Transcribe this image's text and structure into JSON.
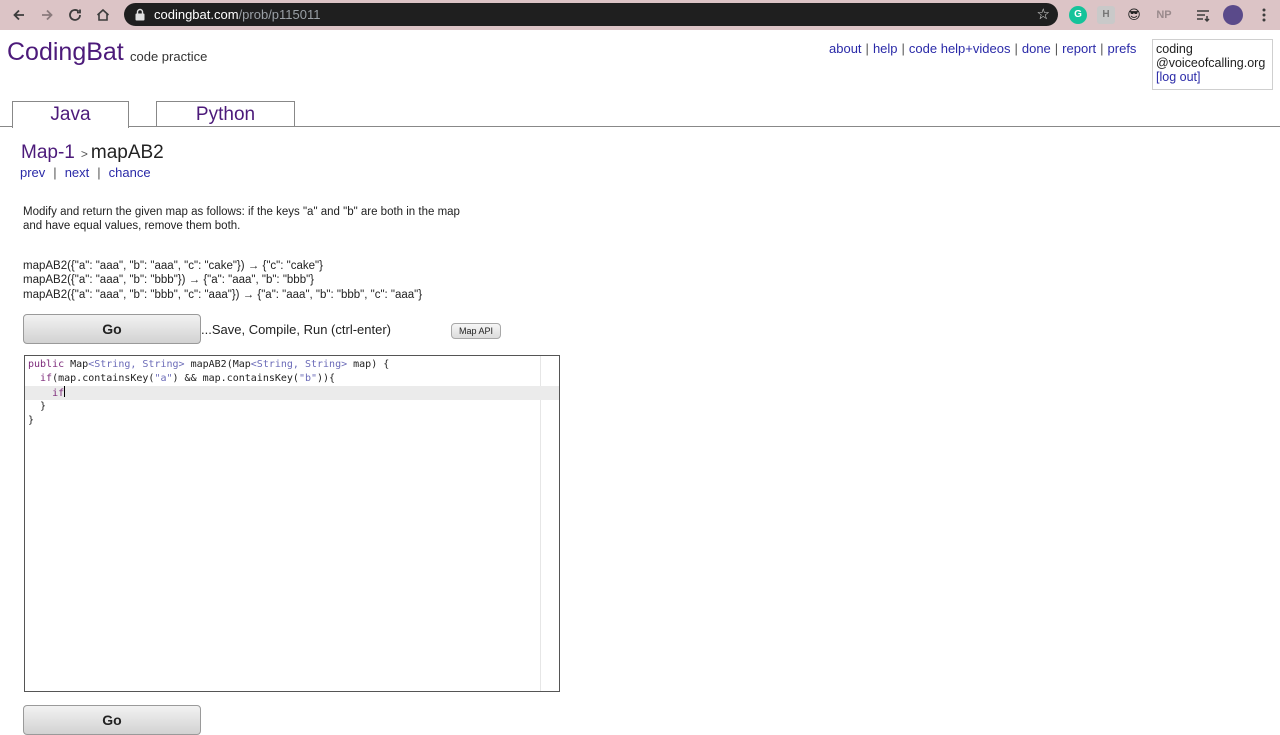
{
  "browser": {
    "url_domain": "codingbat.com",
    "url_path": "/prob/p115011",
    "extensions": [
      "G",
      "H",
      "😎",
      "NP"
    ]
  },
  "header": {
    "logo": "CodingBat",
    "tagline": "code practice",
    "links": [
      "about",
      "help",
      "code help+videos",
      "done",
      "report",
      "prefs"
    ],
    "user_line1": "coding",
    "user_line2": "@voiceofcalling.org",
    "logout": "[log out]"
  },
  "tabs": [
    {
      "label": "Java",
      "active": true
    },
    {
      "label": "Python",
      "active": false
    }
  ],
  "problem": {
    "category": "Map-1",
    "crumb_sep": ">",
    "name": "mapAB2",
    "nav": [
      "prev",
      "next",
      "chance"
    ],
    "description_line1": "Modify and return the given map as follows: if the keys \"a\" and \"b\" are both in the map",
    "description_line2": "and have equal values, remove them both.",
    "examples": [
      "mapAB2({\"a\": \"aaa\", \"b\": \"aaa\", \"c\": \"cake\"}) → {\"c\": \"cake\"}",
      "mapAB2({\"a\": \"aaa\", \"b\": \"bbb\"}) → {\"a\": \"aaa\", \"b\": \"bbb\"}",
      "mapAB2({\"a\": \"aaa\", \"b\": \"bbb\", \"c\": \"aaa\"}) → {\"a\": \"aaa\", \"b\": \"bbb\", \"c\": \"aaa\"}"
    ]
  },
  "actions": {
    "go_label": "Go",
    "go_hint": "...Save, Compile, Run (ctrl-enter)",
    "map_api": "Map API"
  },
  "editor": {
    "line1_a": "public",
    "line1_b": " Map",
    "line1_c": "<String, String>",
    "line1_d": " mapAB2(Map",
    "line1_e": "<String, String>",
    "line1_f": " map) {",
    "line2_a": "  if",
    "line2_b": "(map.containsKey(",
    "line2_c": "\"a\"",
    "line2_d": ") && map.containsKey(",
    "line2_e": "\"b\"",
    "line2_f": ")){",
    "line3": "    if",
    "line4": "  }",
    "line5": "}"
  }
}
